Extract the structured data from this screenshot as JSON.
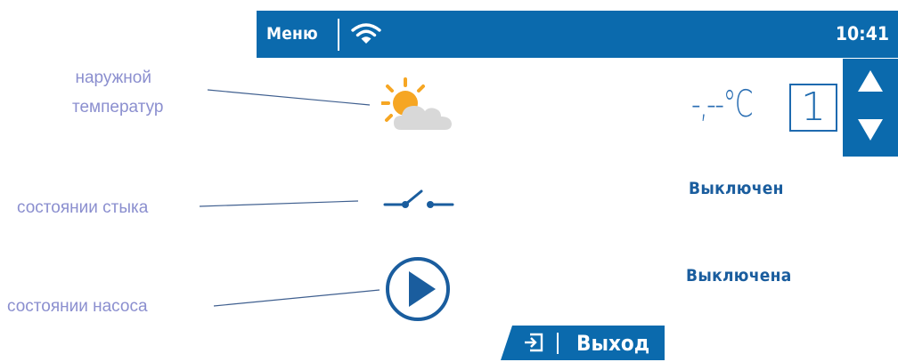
{
  "header": {
    "menu_label": "Меню",
    "time": "10:41",
    "accent_color": "#0b6aad"
  },
  "callouts": {
    "outdoor_temp_line1": "наружной",
    "outdoor_temp_line2": "температур",
    "contact_state": "состоянии стыка",
    "pump_state": "состоянии насоса"
  },
  "outdoor": {
    "temperature_value": "-,--°C",
    "setpoint": "1",
    "icons": [
      "weather-sun-cloud-icon",
      "arrow-up-icon",
      "arrow-down-icon"
    ]
  },
  "contact": {
    "status": "Выключен",
    "icon": "switch-contact-icon"
  },
  "pump": {
    "status": "Выключена",
    "icon": "pump-play-icon"
  },
  "footer": {
    "exit_label": "Выход",
    "exit_icon": "exit-icon"
  }
}
